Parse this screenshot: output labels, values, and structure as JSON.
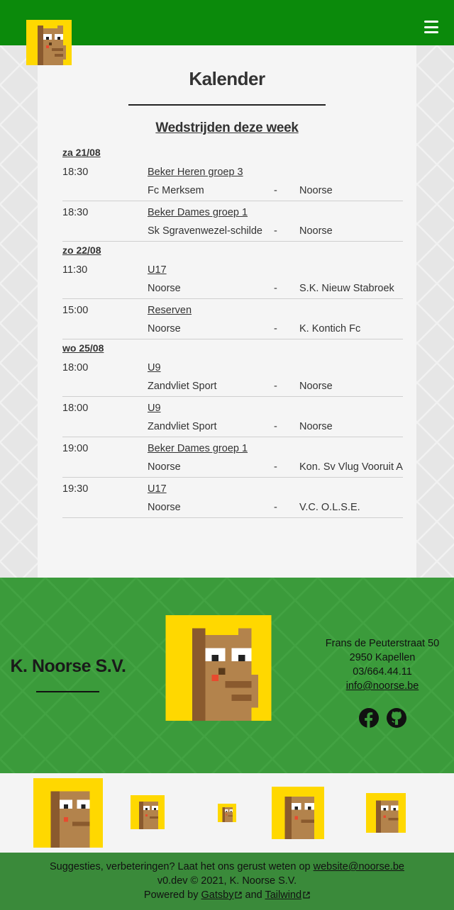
{
  "header": {
    "logo_alt": "K. Noorse S.V. logo",
    "menu_icon": "hamburger-menu-icon",
    "background_color": "#0b8a0b"
  },
  "main": {
    "title": "Kalender",
    "subtitle": "Wedstrijden deze week"
  },
  "days": [
    {
      "label": "za 21/08",
      "matches": [
        {
          "time": "18:30",
          "competition": "Beker Heren groep 3",
          "home": "Fc Merksem",
          "sep": "-",
          "away": "Noorse"
        },
        {
          "time": "18:30",
          "competition": "Beker Dames groep 1",
          "home": "Sk Sgravenwezel-schilde",
          "sep": "-",
          "away": "Noorse"
        }
      ]
    },
    {
      "label": "zo 22/08",
      "matches": [
        {
          "time": "11:30",
          "competition": "U17",
          "home": "Noorse",
          "sep": "-",
          "away": "S.K. Nieuw Stabroek"
        },
        {
          "time": "15:00",
          "competition": "Reserven",
          "home": "Noorse",
          "sep": "-",
          "away": "K. Kontich Fc"
        }
      ]
    },
    {
      "label": "wo 25/08",
      "matches": [
        {
          "time": "18:00",
          "competition": "U9",
          "home": "Zandvliet Sport",
          "sep": "-",
          "away": "Noorse"
        },
        {
          "time": "18:00",
          "competition": "U9",
          "home": "Zandvliet Sport",
          "sep": "-",
          "away": "Noorse"
        },
        {
          "time": "19:00",
          "competition": "Beker Dames groep 1",
          "home": "Noorse",
          "sep": "-",
          "away": "Kon. Sv Vlug Vooruit A"
        },
        {
          "time": "19:30",
          "competition": "U17",
          "home": "Noorse",
          "sep": "-",
          "away": "V.C. O.L.S.E."
        }
      ]
    }
  ],
  "footer": {
    "club_name": "K. Noorse S.V.",
    "address_line1": "Frans de Peuterstraat 50",
    "address_line2": "2950 Kapellen",
    "phone": "03/664.44.11",
    "email": "info@noorse.be",
    "social": [
      "facebook-icon",
      "github-icon"
    ],
    "background_color": "#3b9b3b"
  },
  "bottom": {
    "suggestion_text": "Suggesties, verbeteringen? Laat het ons gerust weten op",
    "suggestion_email": "website@noorse.be",
    "version_text": "v0.dev © 2021, K. Noorse S.V.",
    "powered_by": "Powered by",
    "gatsby": "Gatsby",
    "and": "and",
    "tailwind": "Tailwind"
  }
}
